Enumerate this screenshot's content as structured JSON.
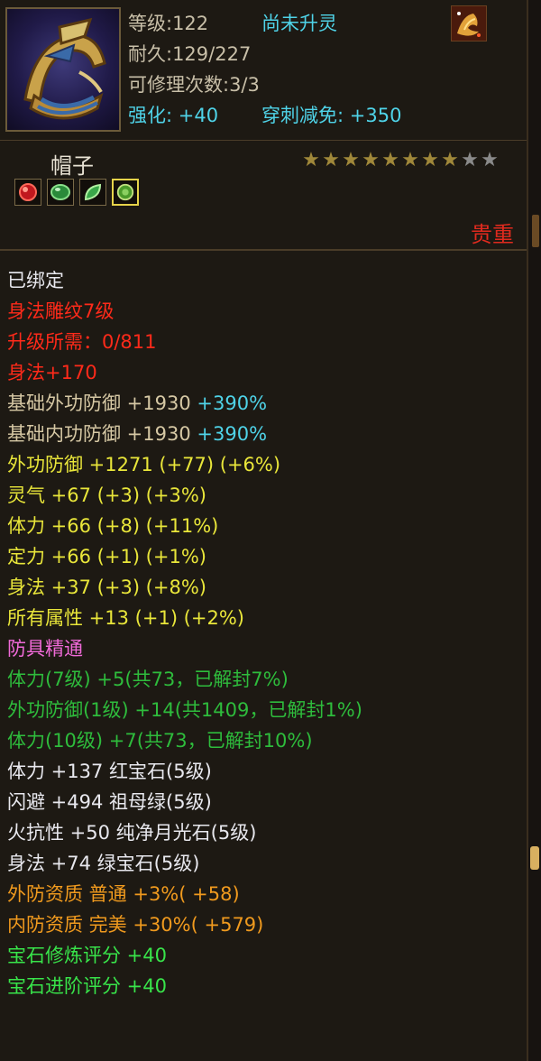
{
  "header": {
    "level_label": "等级",
    "level_value": ":122",
    "upgrade_status": "尚未升灵",
    "durability_label": "耐久",
    "durability_value": ":129/227",
    "repair_label": "可修理次数",
    "repair_value": ":3/3",
    "enhance_label": "强化:",
    "enhance_value": "+40",
    "pierce_label": "穿刺减免:",
    "pierce_value": "+350"
  },
  "item": {
    "name": "帽子",
    "stars_total": 10,
    "stars_filled": 8,
    "quality": "贵重",
    "gem_slots": [
      "red-gem",
      "green-gem",
      "green-leaf-gem",
      "emerald-gem"
    ]
  },
  "attributes": [
    {
      "text": "已绑定",
      "color": "#e8e8ee"
    },
    {
      "text": "身法雕纹7级",
      "color": "#ff2a1a"
    },
    {
      "text": "升级所需：0/811",
      "color": "#ff2a1a"
    },
    {
      "text": "身法+170",
      "color": "#ff2a1a"
    },
    {
      "text": "基础外功防御 +1930",
      "suffix": " +390%",
      "color": "#d6c8a4",
      "suffix_color": "#4fd3e8"
    },
    {
      "text": "基础内功防御 +1930",
      "suffix": " +390%",
      "color": "#d6c8a4",
      "suffix_color": "#4fd3e8"
    },
    {
      "text": "外功防御 +1271 (+77) (+6%)",
      "color": "#e9e63a"
    },
    {
      "text": "灵气 +67 (+3) (+3%)",
      "color": "#e9e63a"
    },
    {
      "text": "体力 +66 (+8) (+11%)",
      "color": "#e9e63a"
    },
    {
      "text": "定力 +66 (+1) (+1%)",
      "color": "#e9e63a"
    },
    {
      "text": "身法 +37 (+3) (+8%)",
      "color": "#e9e63a"
    },
    {
      "text": "所有属性 +13 (+1) (+2%)",
      "color": "#e9e63a"
    },
    {
      "text": "防具精通",
      "color": "#f06ad8"
    },
    {
      "text": "体力(7级) +5(共73，已解封7%)",
      "color": "#2ebc3c"
    },
    {
      "text": "外功防御(1级) +14(共1409，已解封1%)",
      "color": "#2ebc3c"
    },
    {
      "text": "体力(10级) +7(共73，已解封10%)",
      "color": "#2ebc3c"
    },
    {
      "text": "体力 +137 红宝石(5级)",
      "color": "#e8e8ee"
    },
    {
      "text": "闪避 +494 祖母绿(5级)",
      "color": "#e8e8ee"
    },
    {
      "text": "火抗性 +50 纯净月光石(5级)",
      "color": "#e8e8ee"
    },
    {
      "text": "身法 +74 绿宝石(5级)",
      "color": "#e8e8ee"
    },
    {
      "text": "外防资质  普通 +3%( +58)",
      "color": "#f09a1e"
    },
    {
      "text": "内防资质  完美 +30%( +579)",
      "color": "#f09a1e"
    },
    {
      "text": "宝石修炼评分 +40",
      "color": "#38e44a"
    },
    {
      "text": "宝石进阶评分 +40",
      "color": "#38e44a"
    }
  ]
}
